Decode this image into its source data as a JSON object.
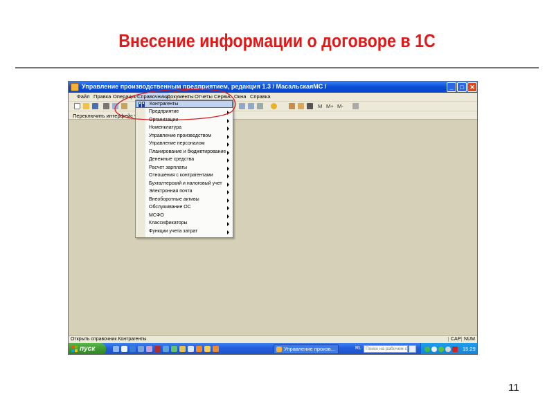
{
  "slide": {
    "title": "Внесение информации о договоре в 1С",
    "page_number": "11"
  },
  "window": {
    "title": "Управление производственным предприятием, редакция 1.3 / МасальскаяМС /",
    "min_glyph": "_",
    "max_glyph": "□",
    "close_glyph": "✕"
  },
  "menubar": {
    "items": [
      {
        "label": "Файл"
      },
      {
        "label": "Правка"
      },
      {
        "label": "Операции"
      },
      {
        "label": "Справочники"
      },
      {
        "label": "Документы"
      },
      {
        "label": "Отчеты"
      },
      {
        "label": "Сервис"
      },
      {
        "label": "Окна"
      },
      {
        "label": "Справка"
      }
    ]
  },
  "toolbar": {
    "labels": [
      "М",
      "М+",
      "М-"
    ]
  },
  "interface_bar": {
    "label": "Переключить интерфейс ▾"
  },
  "dropdown": {
    "items": [
      {
        "label": "Контрагенты",
        "submenu": false,
        "highlighted": true
      },
      {
        "label": "Предприятие",
        "submenu": true
      },
      {
        "label": "Организации",
        "submenu": true
      },
      {
        "label": "Номенклатура",
        "submenu": true
      },
      {
        "label": "Управление производством",
        "submenu": true
      },
      {
        "label": "Управление персоналом",
        "submenu": true
      },
      {
        "label": "Планирование и бюджетирование",
        "submenu": true
      },
      {
        "label": "Денежные средства",
        "submenu": true
      },
      {
        "label": "Расчет зарплаты",
        "submenu": true
      },
      {
        "label": "Отношения с контрагентами",
        "submenu": true
      },
      {
        "label": "Бухгалтерский и налоговый учет",
        "submenu": true
      },
      {
        "label": "Электронная почта",
        "submenu": true
      },
      {
        "label": "Внеоборотные активы",
        "submenu": true
      },
      {
        "label": "Обслуживание ОС",
        "submenu": true
      },
      {
        "label": "МСФО",
        "submenu": true
      },
      {
        "label": "Классификаторы",
        "submenu": true
      },
      {
        "label": "Функции учета затрат",
        "submenu": true
      }
    ]
  },
  "statusbar": {
    "text": "Открыть справочник Контрагенты",
    "cap": "CAP",
    "num": "NUM"
  },
  "taskbar": {
    "start_label": "пуск",
    "task_label": "Управление произв...",
    "lang": "RL",
    "search_placeholder": "Поиск на рабочем столе",
    "clock": "15:29"
  },
  "colors": {
    "title_red": "#e01818",
    "workspace": "#d5d0b6",
    "xp_blue": "#0a4fd8",
    "start_green": "#3a962c",
    "annotation_red": "#d61c1c"
  }
}
